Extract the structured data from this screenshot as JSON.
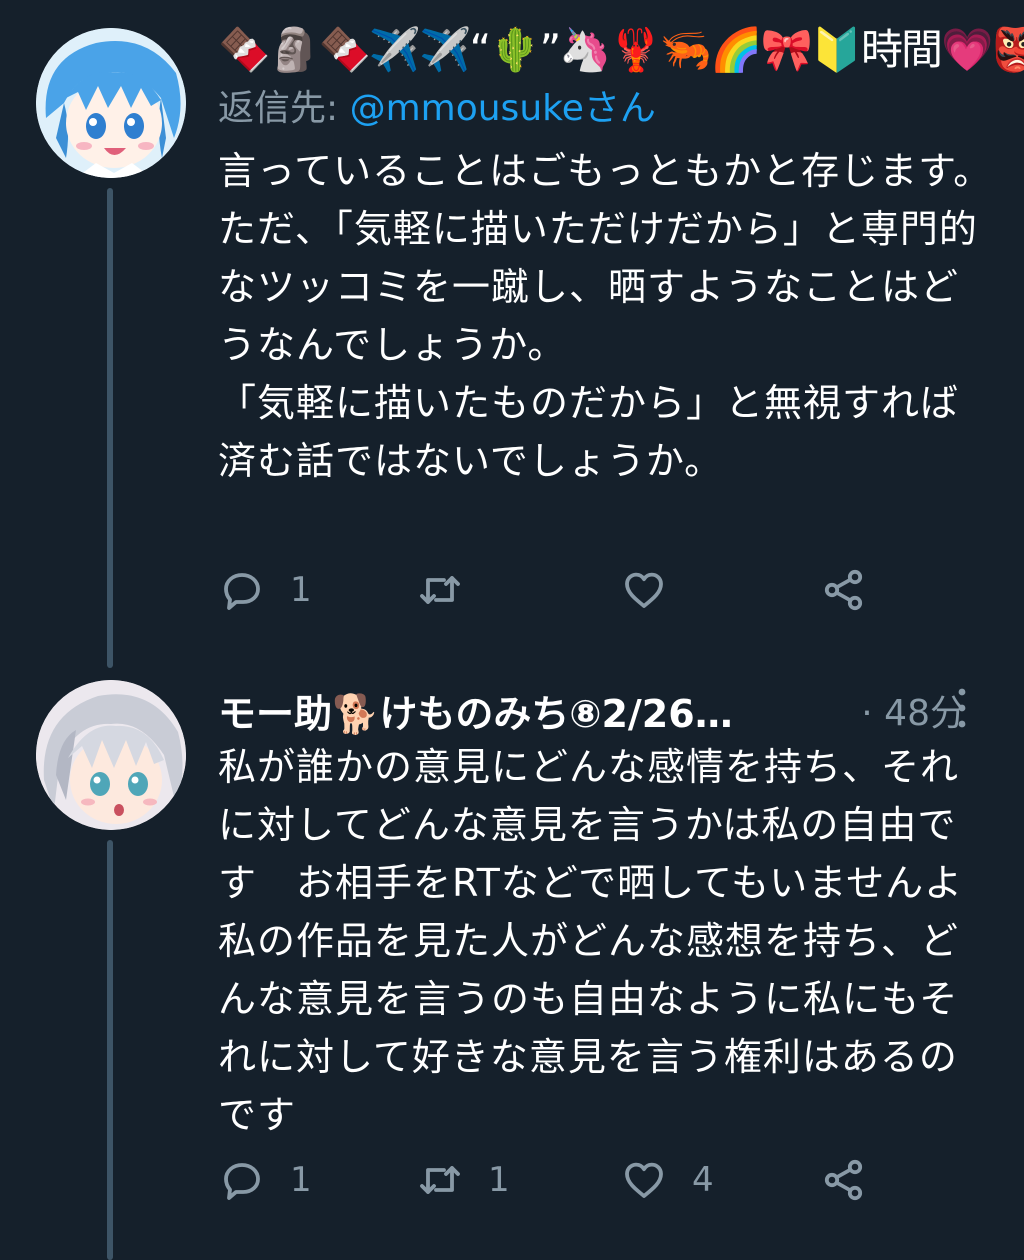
{
  "tweets": [
    {
      "display_name": "🍫🗿🍫✈️✈️“🌵”🦄🦞🦐🌈🎀🔰時間💗👺🍼",
      "reply_prefix": "返信先: ",
      "reply_handle": "@mmousukeさん",
      "text": "言っていることはごもっともかと存じます。\nただ、「気軽に描いただけだから」と専門的なツッコミを一蹴し、晒すようなことはどうなんでしょうか。\n「気軽に描いたものだから」と無視すれば済む話ではないでしょうか。",
      "reply_count": "1",
      "retweet_count": "",
      "like_count": ""
    },
    {
      "display_name": "モー助🐕けものみち⑧2/26…",
      "meta": "· 48分",
      "text": "私が誰かの意見にどんな感情を持ち、それに対してどんな意見を言うかは私の自由です　お相手をRTなどで晒してもいませんよ　私の作品を見た人がどんな感想を持ち、どんな意見を言うのも自由なように私にもそれに対して好きな意見を言う権利はあるのです",
      "reply_count": "1",
      "retweet_count": "1",
      "like_count": "4"
    }
  ],
  "colors": {
    "background": "#15202b",
    "secondary_text": "#8899a6",
    "link": "#1da1f2",
    "thread_line": "#3d5466"
  },
  "icons": [
    "reply-icon",
    "retweet-icon",
    "like-icon",
    "share-icon",
    "more-icon"
  ]
}
